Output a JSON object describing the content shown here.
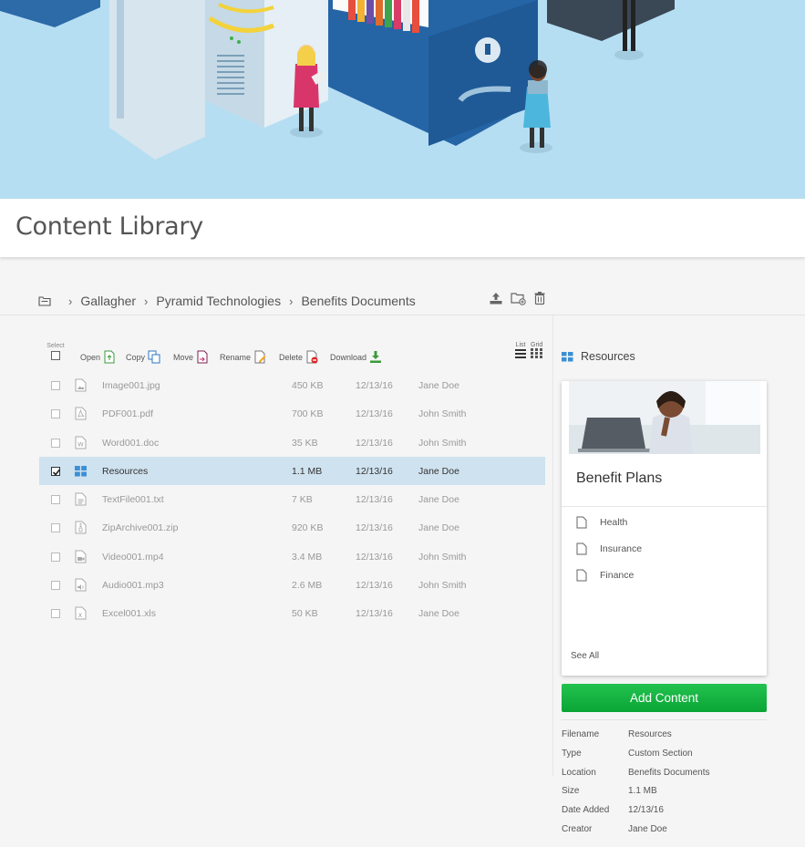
{
  "page": {
    "title": "Content Library"
  },
  "breadcrumb": {
    "items": [
      "Gallagher",
      "Pyramid Technologies",
      "Benefits Documents"
    ]
  },
  "toolbar": {
    "select_label": "Select",
    "actions": [
      {
        "label": "Open",
        "icon": "open-icon"
      },
      {
        "label": "Copy",
        "icon": "copy-icon"
      },
      {
        "label": "Move",
        "icon": "move-icon"
      },
      {
        "label": "Rename",
        "icon": "rename-icon"
      },
      {
        "label": "Delete",
        "icon": "delete-icon"
      },
      {
        "label": "Download",
        "icon": "download-icon"
      }
    ],
    "view_list": "List",
    "view_grid": "Grid"
  },
  "files": [
    {
      "name": "Image001.jpg",
      "size": "450 KB",
      "date": "12/13/16",
      "creator": "Jane Doe",
      "icon": "image-file-icon",
      "checked": false
    },
    {
      "name": "PDF001.pdf",
      "size": "700 KB",
      "date": "12/13/16",
      "creator": "John Smith",
      "icon": "pdf-file-icon",
      "checked": false
    },
    {
      "name": "Word001.doc",
      "size": "35 KB",
      "date": "12/13/16",
      "creator": "John Smith",
      "icon": "word-file-icon",
      "checked": false
    },
    {
      "name": "Resources",
      "size": "1.1 MB",
      "date": "12/13/16",
      "creator": "Jane Doe",
      "icon": "section-grid-icon",
      "checked": true
    },
    {
      "name": "TextFile001.txt",
      "size": "7 KB",
      "date": "12/13/16",
      "creator": "Jane Doe",
      "icon": "text-file-icon",
      "checked": false
    },
    {
      "name": "ZipArchive001.zip",
      "size": "920 KB",
      "date": "12/13/16",
      "creator": "Jane Doe",
      "icon": "zip-file-icon",
      "checked": false
    },
    {
      "name": "Video001.mp4",
      "size": "3.4 MB",
      "date": "12/13/16",
      "creator": "John Smith",
      "icon": "video-file-icon",
      "checked": false
    },
    {
      "name": "Audio001.mp3",
      "size": "2.6 MB",
      "date": "12/13/16",
      "creator": "John Smith",
      "icon": "audio-file-icon",
      "checked": false
    },
    {
      "name": "Excel001.xls",
      "size": "50 KB",
      "date": "12/13/16",
      "creator": "Jane Doe",
      "icon": "excel-file-icon",
      "checked": false
    }
  ],
  "panel": {
    "title": "Resources",
    "card": {
      "title": "Benefit Plans",
      "items": [
        "Health",
        "Insurance",
        "Finance"
      ],
      "see_all": "See All"
    },
    "add_button": "Add Content",
    "properties": [
      {
        "key": "Filename",
        "value": "Resources"
      },
      {
        "key": "Type",
        "value": "Custom Section"
      },
      {
        "key": "Location",
        "value": "Benefits Documents"
      },
      {
        "key": "Size",
        "value": "1.1 MB"
      },
      {
        "key": "Date Added",
        "value": "12/13/16"
      },
      {
        "key": "Creator",
        "value": "Jane Doe"
      }
    ]
  },
  "colors": {
    "accent_green": "#0aa535",
    "selection": "#cfe2ef",
    "hero_bg": "#b6def2"
  }
}
